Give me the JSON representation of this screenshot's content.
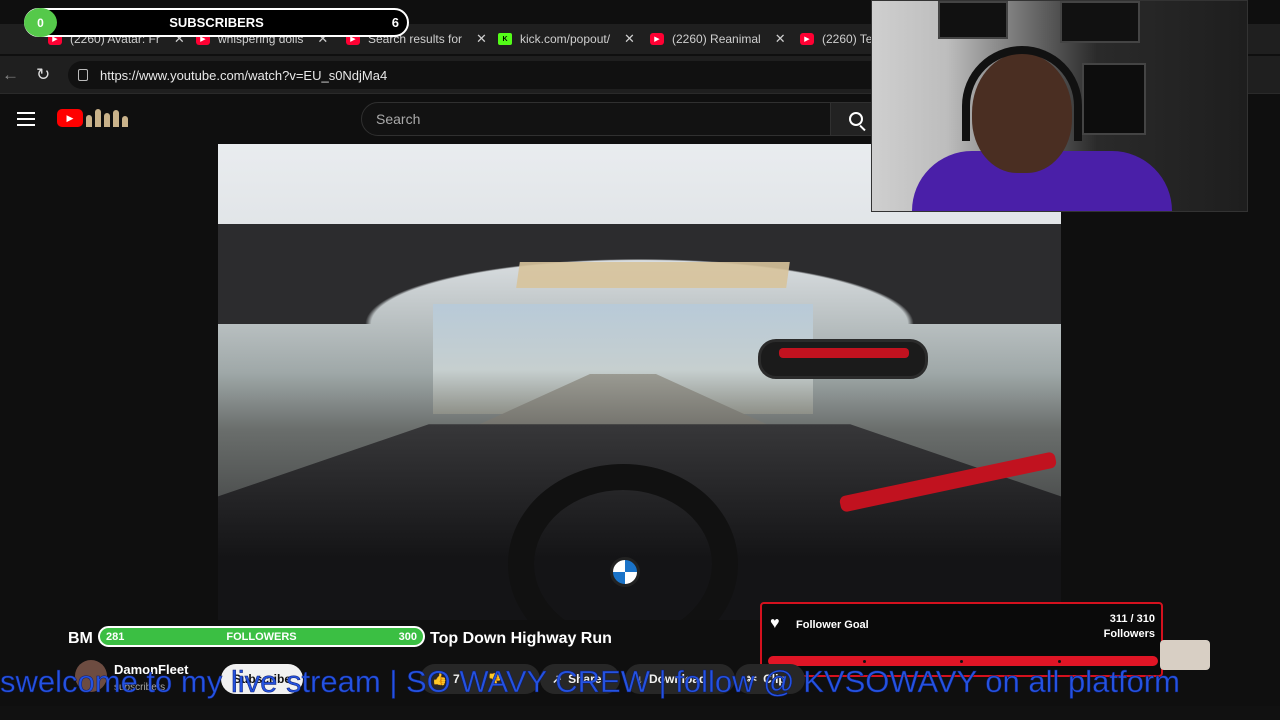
{
  "overlays": {
    "subscribers": {
      "count_left": "0",
      "label": "SUBSCRIBERS",
      "count_right": "6"
    },
    "followers": {
      "current": "281",
      "label": "FOLLOWERS",
      "goal": "300"
    },
    "follower_goal": {
      "title": "Follower Goal",
      "count": "311 / 310",
      "unit": "Followers",
      "progress": 1.0
    },
    "marquee": "swelcome to my live stream | SO WAVY CREW | follow @ KVSOWAVY on all platform"
  },
  "browser": {
    "tabs": [
      {
        "label": "(2260) Avatar: Fr",
        "icon": "youtube-icon"
      },
      {
        "label": "whispering dolls",
        "icon": "youtube-icon"
      },
      {
        "label": "Search results for",
        "icon": "youtube-icon"
      },
      {
        "label": "kick.com/popout/",
        "icon": "kick-icon"
      },
      {
        "label": "(2260) Reanimal",
        "icon": "youtube-icon"
      },
      {
        "label": "(2260) Te",
        "icon": "youtube-icon"
      }
    ],
    "url": "https://www.youtube.com/watch?v=EU_s0NdjMa4"
  },
  "youtube": {
    "search_placeholder": "Search",
    "video_title_left": "BM",
    "video_title_right": "Top Down Highway Run",
    "channel": {
      "name": "DamonFleet",
      "subscribers": "subscribers"
    },
    "subscribe_label": "Subscribe",
    "actions": {
      "likes": "7",
      "share": "Share",
      "download": "Download",
      "clip": "Clip"
    }
  },
  "colors": {
    "accent_red": "#ff0000",
    "follower_green": "#3bbf43",
    "goal_red": "#e01525",
    "marquee_blue": "#2553e0"
  }
}
